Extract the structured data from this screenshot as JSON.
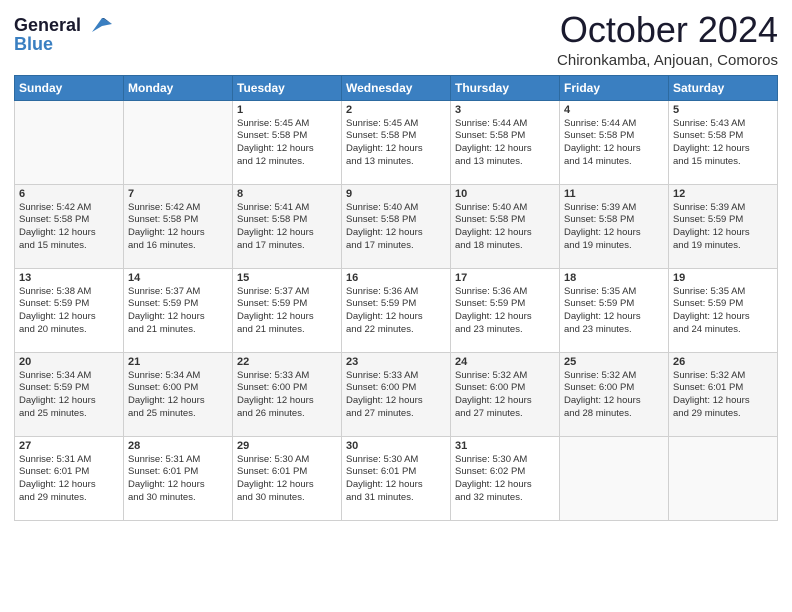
{
  "header": {
    "logo_line1": "General",
    "logo_line2": "Blue",
    "title": "October 2024",
    "location": "Chironkamba, Anjouan, Comoros"
  },
  "days_of_week": [
    "Sunday",
    "Monday",
    "Tuesday",
    "Wednesday",
    "Thursday",
    "Friday",
    "Saturday"
  ],
  "weeks": [
    [
      {
        "day": "",
        "lines": []
      },
      {
        "day": "",
        "lines": []
      },
      {
        "day": "1",
        "lines": [
          "Sunrise: 5:45 AM",
          "Sunset: 5:58 PM",
          "Daylight: 12 hours",
          "and 12 minutes."
        ]
      },
      {
        "day": "2",
        "lines": [
          "Sunrise: 5:45 AM",
          "Sunset: 5:58 PM",
          "Daylight: 12 hours",
          "and 13 minutes."
        ]
      },
      {
        "day": "3",
        "lines": [
          "Sunrise: 5:44 AM",
          "Sunset: 5:58 PM",
          "Daylight: 12 hours",
          "and 13 minutes."
        ]
      },
      {
        "day": "4",
        "lines": [
          "Sunrise: 5:44 AM",
          "Sunset: 5:58 PM",
          "Daylight: 12 hours",
          "and 14 minutes."
        ]
      },
      {
        "day": "5",
        "lines": [
          "Sunrise: 5:43 AM",
          "Sunset: 5:58 PM",
          "Daylight: 12 hours",
          "and 15 minutes."
        ]
      }
    ],
    [
      {
        "day": "6",
        "lines": [
          "Sunrise: 5:42 AM",
          "Sunset: 5:58 PM",
          "Daylight: 12 hours",
          "and 15 minutes."
        ]
      },
      {
        "day": "7",
        "lines": [
          "Sunrise: 5:42 AM",
          "Sunset: 5:58 PM",
          "Daylight: 12 hours",
          "and 16 minutes."
        ]
      },
      {
        "day": "8",
        "lines": [
          "Sunrise: 5:41 AM",
          "Sunset: 5:58 PM",
          "Daylight: 12 hours",
          "and 17 minutes."
        ]
      },
      {
        "day": "9",
        "lines": [
          "Sunrise: 5:40 AM",
          "Sunset: 5:58 PM",
          "Daylight: 12 hours",
          "and 17 minutes."
        ]
      },
      {
        "day": "10",
        "lines": [
          "Sunrise: 5:40 AM",
          "Sunset: 5:58 PM",
          "Daylight: 12 hours",
          "and 18 minutes."
        ]
      },
      {
        "day": "11",
        "lines": [
          "Sunrise: 5:39 AM",
          "Sunset: 5:58 PM",
          "Daylight: 12 hours",
          "and 19 minutes."
        ]
      },
      {
        "day": "12",
        "lines": [
          "Sunrise: 5:39 AM",
          "Sunset: 5:59 PM",
          "Daylight: 12 hours",
          "and 19 minutes."
        ]
      }
    ],
    [
      {
        "day": "13",
        "lines": [
          "Sunrise: 5:38 AM",
          "Sunset: 5:59 PM",
          "Daylight: 12 hours",
          "and 20 minutes."
        ]
      },
      {
        "day": "14",
        "lines": [
          "Sunrise: 5:37 AM",
          "Sunset: 5:59 PM",
          "Daylight: 12 hours",
          "and 21 minutes."
        ]
      },
      {
        "day": "15",
        "lines": [
          "Sunrise: 5:37 AM",
          "Sunset: 5:59 PM",
          "Daylight: 12 hours",
          "and 21 minutes."
        ]
      },
      {
        "day": "16",
        "lines": [
          "Sunrise: 5:36 AM",
          "Sunset: 5:59 PM",
          "Daylight: 12 hours",
          "and 22 minutes."
        ]
      },
      {
        "day": "17",
        "lines": [
          "Sunrise: 5:36 AM",
          "Sunset: 5:59 PM",
          "Daylight: 12 hours",
          "and 23 minutes."
        ]
      },
      {
        "day": "18",
        "lines": [
          "Sunrise: 5:35 AM",
          "Sunset: 5:59 PM",
          "Daylight: 12 hours",
          "and 23 minutes."
        ]
      },
      {
        "day": "19",
        "lines": [
          "Sunrise: 5:35 AM",
          "Sunset: 5:59 PM",
          "Daylight: 12 hours",
          "and 24 minutes."
        ]
      }
    ],
    [
      {
        "day": "20",
        "lines": [
          "Sunrise: 5:34 AM",
          "Sunset: 5:59 PM",
          "Daylight: 12 hours",
          "and 25 minutes."
        ]
      },
      {
        "day": "21",
        "lines": [
          "Sunrise: 5:34 AM",
          "Sunset: 6:00 PM",
          "Daylight: 12 hours",
          "and 25 minutes."
        ]
      },
      {
        "day": "22",
        "lines": [
          "Sunrise: 5:33 AM",
          "Sunset: 6:00 PM",
          "Daylight: 12 hours",
          "and 26 minutes."
        ]
      },
      {
        "day": "23",
        "lines": [
          "Sunrise: 5:33 AM",
          "Sunset: 6:00 PM",
          "Daylight: 12 hours",
          "and 27 minutes."
        ]
      },
      {
        "day": "24",
        "lines": [
          "Sunrise: 5:32 AM",
          "Sunset: 6:00 PM",
          "Daylight: 12 hours",
          "and 27 minutes."
        ]
      },
      {
        "day": "25",
        "lines": [
          "Sunrise: 5:32 AM",
          "Sunset: 6:00 PM",
          "Daylight: 12 hours",
          "and 28 minutes."
        ]
      },
      {
        "day": "26",
        "lines": [
          "Sunrise: 5:32 AM",
          "Sunset: 6:01 PM",
          "Daylight: 12 hours",
          "and 29 minutes."
        ]
      }
    ],
    [
      {
        "day": "27",
        "lines": [
          "Sunrise: 5:31 AM",
          "Sunset: 6:01 PM",
          "Daylight: 12 hours",
          "and 29 minutes."
        ]
      },
      {
        "day": "28",
        "lines": [
          "Sunrise: 5:31 AM",
          "Sunset: 6:01 PM",
          "Daylight: 12 hours",
          "and 30 minutes."
        ]
      },
      {
        "day": "29",
        "lines": [
          "Sunrise: 5:30 AM",
          "Sunset: 6:01 PM",
          "Daylight: 12 hours",
          "and 30 minutes."
        ]
      },
      {
        "day": "30",
        "lines": [
          "Sunrise: 5:30 AM",
          "Sunset: 6:01 PM",
          "Daylight: 12 hours",
          "and 31 minutes."
        ]
      },
      {
        "day": "31",
        "lines": [
          "Sunrise: 5:30 AM",
          "Sunset: 6:02 PM",
          "Daylight: 12 hours",
          "and 32 minutes."
        ]
      },
      {
        "day": "",
        "lines": []
      },
      {
        "day": "",
        "lines": []
      }
    ]
  ]
}
